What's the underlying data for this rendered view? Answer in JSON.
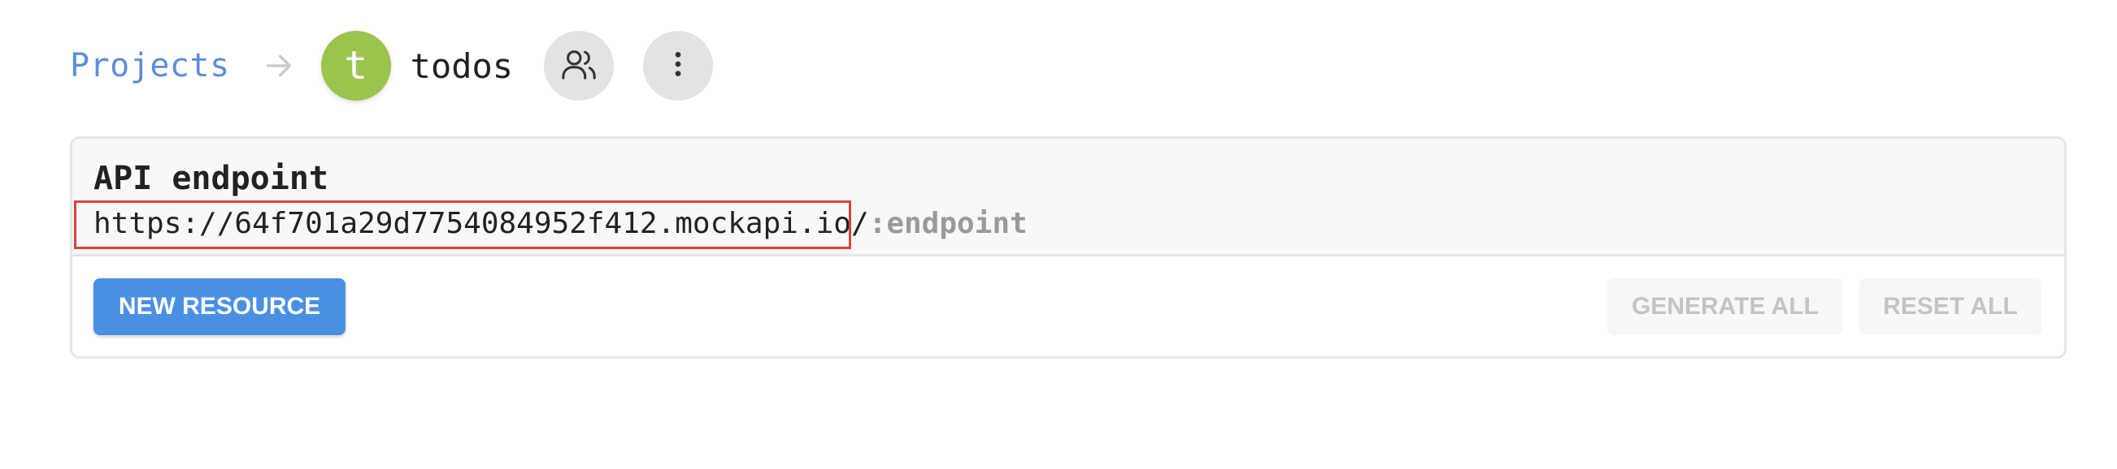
{
  "header": {
    "breadcrumb_root": "Projects",
    "project_initial": "t",
    "project_name": "todos",
    "icons": {
      "arrow": "arrow-right-icon",
      "users": "users-icon",
      "more": "more-vertical-icon"
    }
  },
  "api_card": {
    "title": "API endpoint",
    "base_url": "https://64f701a29d7754084952f412.mockapi.io/",
    "endpoint_placeholder": ":endpoint",
    "new_resource_label": "NEW RESOURCE",
    "generate_all_label": "GENERATE ALL",
    "reset_all_label": "RESET ALL"
  },
  "colors": {
    "link": "#5c8ed6",
    "avatar": "#9cc34b",
    "primary": "#4a90e2",
    "highlight": "#d9443a"
  }
}
